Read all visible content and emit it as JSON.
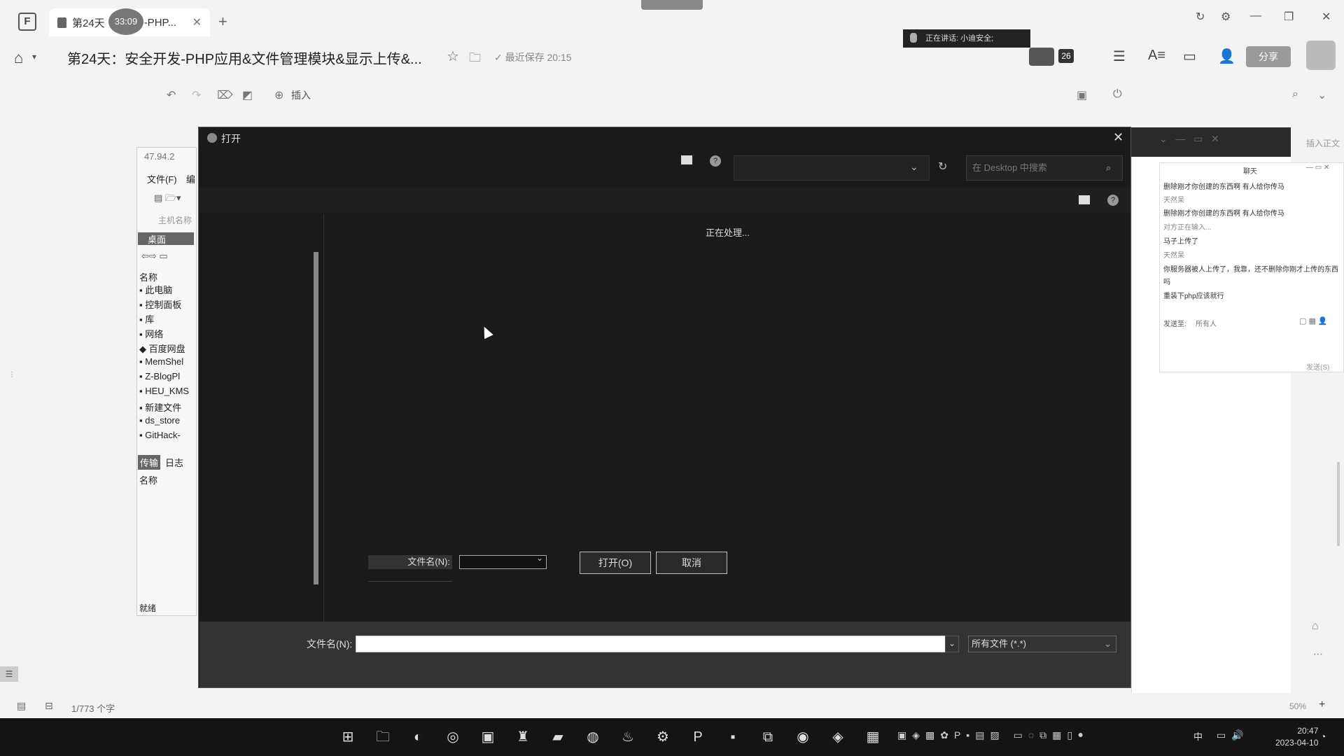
{
  "browser": {
    "tab_title": "第24天",
    "tab_title_suffix": "-PHP...",
    "timer": "33:09"
  },
  "document": {
    "title": "第24天：安全开发-PHP应用&文件管理模块&显示上传&...",
    "saved_status": "最近保存 20:15",
    "share_label": "分享",
    "banner_text": "正在讲话: 小迪安全;",
    "badge_count": "26",
    "insert_label": "插入",
    "page_info": "1/773 个字",
    "zoom": "50%"
  },
  "file_manager": {
    "address": "47.94.2",
    "menu_file": "文件(F)",
    "menu_edit": "编",
    "host_label": "主机名称",
    "desktop_label": "桌面",
    "tree_header": "名称",
    "tree_items": [
      "此电脑",
      "控制面板",
      "库",
      "网络",
      "百度网盘",
      "MemShel",
      "Z-BlogPl",
      "HEU_KMS",
      "新建文件",
      "ds_store",
      "GitHack-"
    ],
    "bottom_tabs": [
      "传输",
      "日志"
    ],
    "bottom_header": "名称",
    "status": "就绪"
  },
  "chat": {
    "title": "聊天",
    "messages": [
      "删除刚才你创建的东西啊  有人给你传马",
      "天然呆",
      "删除刚才你创建的东西啊  有人给你传马",
      "对方正在输入...",
      "马子上传了",
      "天然呆",
      "你服务器被人上传了，我靠，还不删除你刚才上传的东西",
      "吗",
      "重装下php应该就行"
    ],
    "send_to_label": "发送至:",
    "send_to_value": "所有人",
    "send_label": "发送(S)"
  },
  "dialog": {
    "title": "打开",
    "search_placeholder": "在 Desktop 中搜索",
    "processing": "正在处理...",
    "inner_filename_label": "文件名(N):",
    "inner_open_button": "打开(O)",
    "inner_cancel_button": "取消",
    "filename_label": "文件名(N):",
    "filename_value": "",
    "filetype_value": "所有文件 (*.*)"
  },
  "taskbar": {
    "time": "20:47",
    "date": "2023-04-10",
    "ime": "中"
  }
}
